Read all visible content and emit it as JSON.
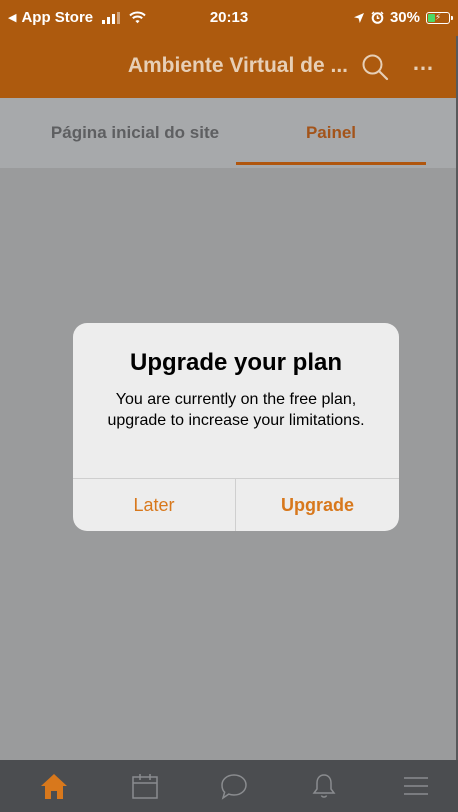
{
  "status_bar": {
    "back_label": "App Store",
    "time": "20:13",
    "battery_percent": "30%",
    "battery_level": 0.3,
    "icons": [
      "back-arrow-icon",
      "signal-icon",
      "wifi-icon",
      "location-icon",
      "alarm-icon",
      "battery-charging-icon"
    ]
  },
  "nav": {
    "title": "Ambiente Virtual de ...",
    "search_icon": "search-icon",
    "more_icon": "more-icon",
    "more_glyph": "…"
  },
  "tabs": [
    {
      "label": "Página inicial do site",
      "selected": false
    },
    {
      "label": "Painel",
      "selected": true
    }
  ],
  "dialog": {
    "title": "Upgrade your plan",
    "message": "You are currently on the free plan, upgrade to increase your limitations.",
    "buttons": {
      "later": "Later",
      "upgrade": "Upgrade"
    }
  },
  "bottom_nav": {
    "items": [
      {
        "icon": "home-icon",
        "selected": true
      },
      {
        "icon": "calendar-icon",
        "selected": false
      },
      {
        "icon": "chat-icon",
        "selected": false
      },
      {
        "icon": "bell-icon",
        "selected": false
      },
      {
        "icon": "menu-icon",
        "selected": false
      }
    ]
  },
  "colors": {
    "brand": "#ad5a0e",
    "accent": "#d8781c",
    "tab_bar": "#4b4d50"
  }
}
